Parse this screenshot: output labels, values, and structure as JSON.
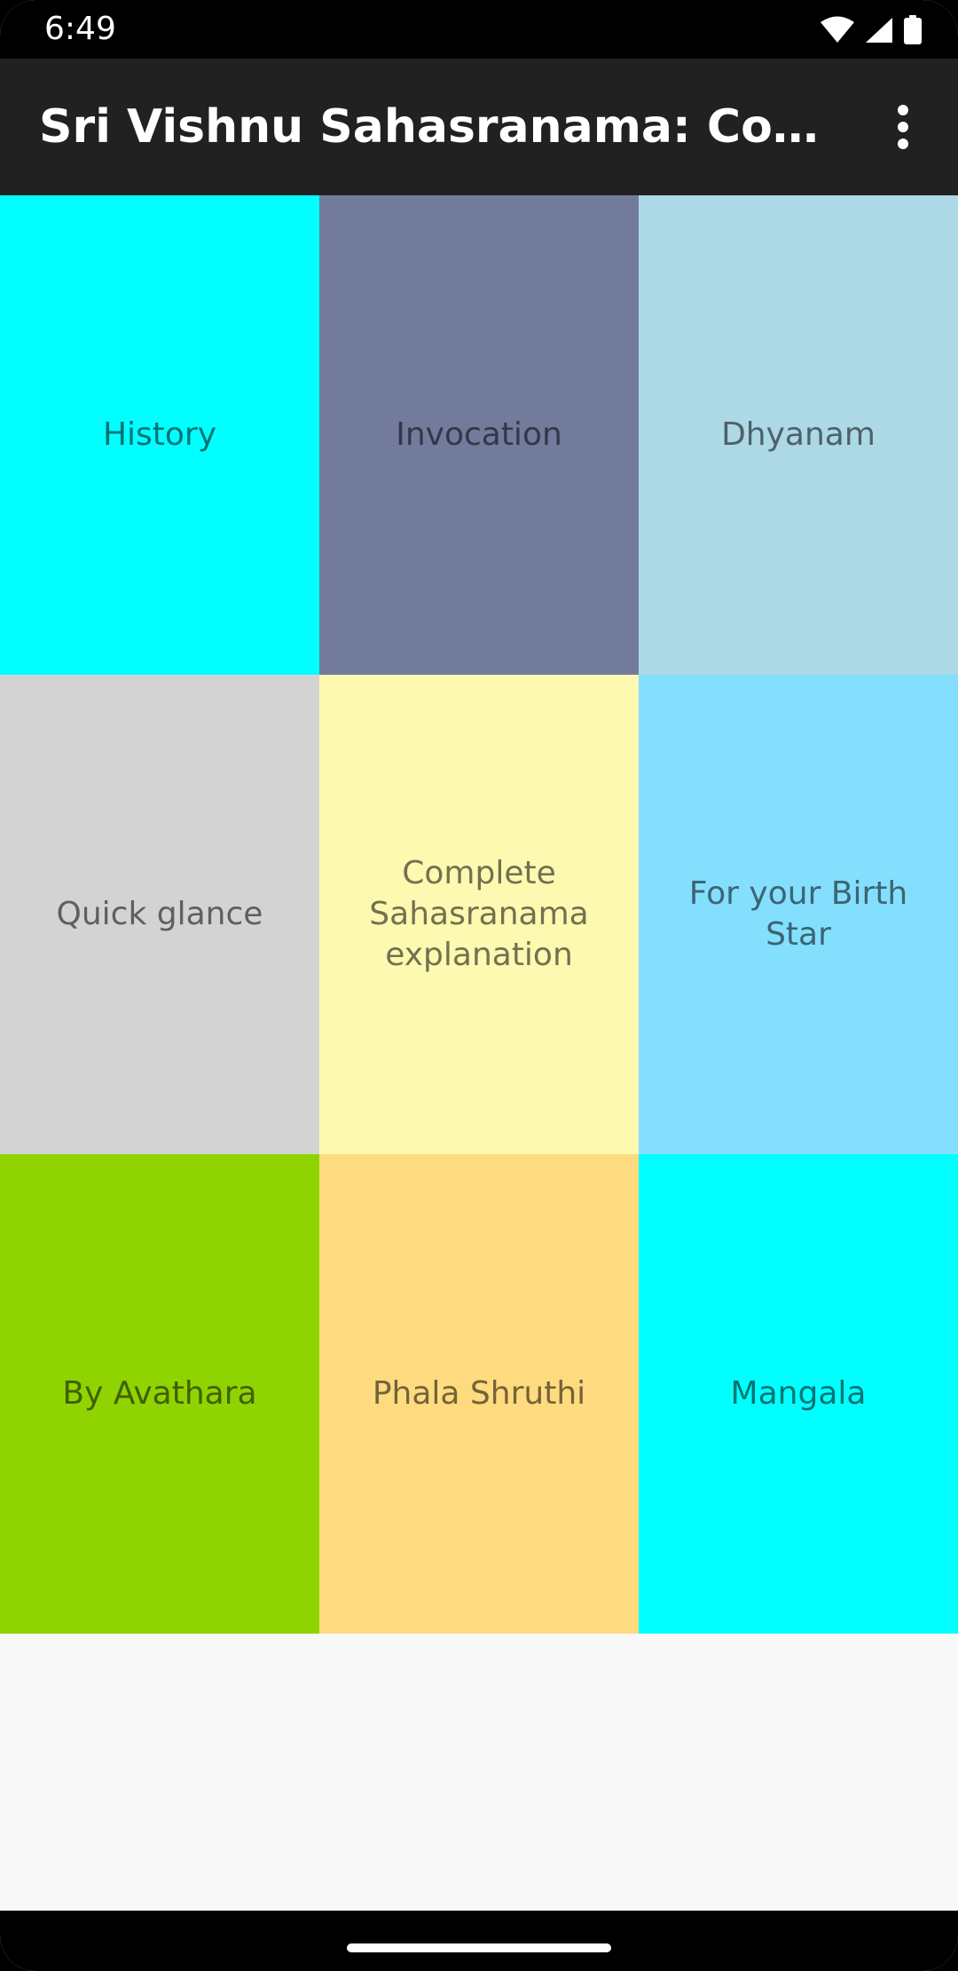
{
  "status_bar": {
    "time": "6:49",
    "icons": [
      "wifi-icon",
      "cellular-signal-icon",
      "battery-icon"
    ]
  },
  "app_bar": {
    "title": "Sri Vishnu Sahasranama: Complete Sahasranama",
    "menu_icon": "more-vert-icon"
  },
  "tiles": [
    {
      "label": "History",
      "color": "#00ffff"
    },
    {
      "label": "Invocation",
      "color": "#727b9c"
    },
    {
      "label": "Dhyanam",
      "color": "#add8e6"
    },
    {
      "label": "Quick glance",
      "color": "#d3d3d3"
    },
    {
      "label": "Complete Sahasranama explanation",
      "color": "#fdf9b0"
    },
    {
      "label": "For your Birth Star",
      "color": "#84dfff"
    },
    {
      "label": "By Avathara",
      "color": "#8fd400"
    },
    {
      "label": "Phala Shruthi",
      "color": "#ffdb7f"
    },
    {
      "label": "Mangala",
      "color": "#00ffff"
    }
  ],
  "colors": {
    "app_bar": "#212121",
    "background": "#f8f8f8"
  }
}
